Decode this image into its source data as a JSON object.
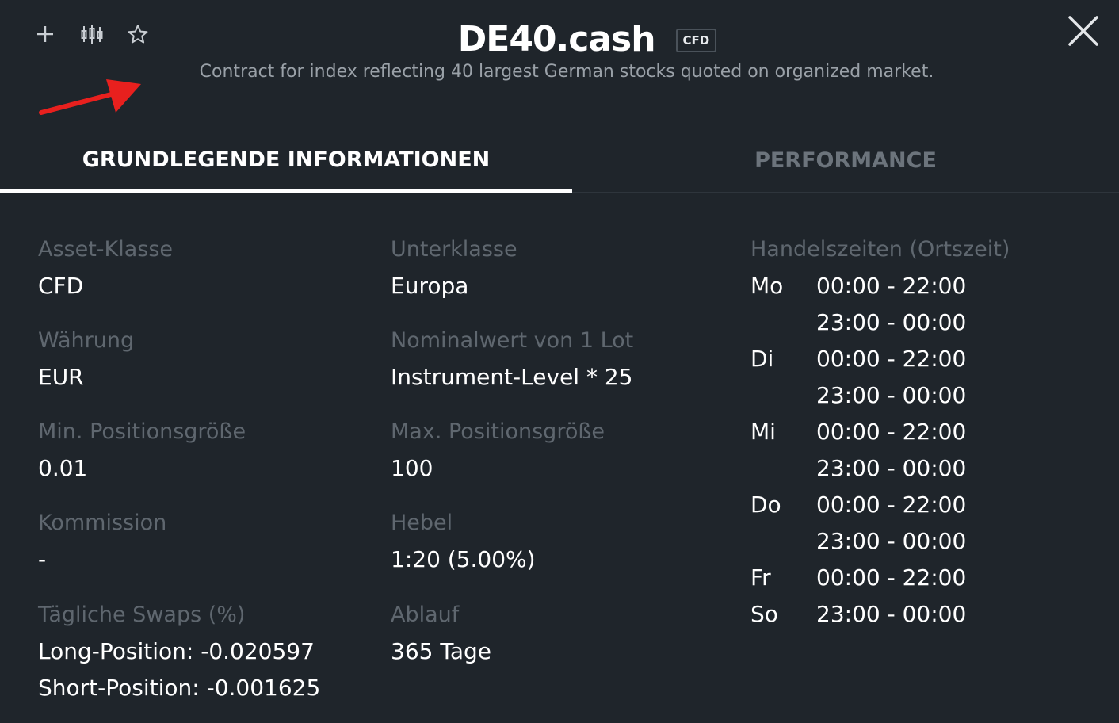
{
  "header": {
    "title": "DE40.cash",
    "badge": "CFD",
    "description": "Contract for index reflecting 40 largest German stocks quoted on organized market.",
    "icons": [
      "plus-icon",
      "candlestick-chart-icon",
      "star-icon",
      "close-icon"
    ]
  },
  "tabs": [
    {
      "label": "GRUNDLEGENDE INFORMATIONEN",
      "active": true
    },
    {
      "label": "PERFORMANCE",
      "active": false
    }
  ],
  "info": {
    "asset_class": {
      "label": "Asset-Klasse",
      "value": "CFD"
    },
    "subclass": {
      "label": "Unterklasse",
      "value": "Europa"
    },
    "currency": {
      "label": "Währung",
      "value": "EUR"
    },
    "nominal": {
      "label": "Nominalwert von 1 Lot",
      "value": "Instrument-Level * 25"
    },
    "min_size": {
      "label": "Min. Positionsgröße",
      "value": "0.01"
    },
    "max_size": {
      "label": "Max. Positionsgröße",
      "value": "100"
    },
    "commission": {
      "label": "Kommission",
      "value": "-"
    },
    "leverage": {
      "label": "Hebel",
      "value": "1:20 (5.00%)"
    },
    "swaps": {
      "label": "Tägliche Swaps (%)",
      "long": "Long-Position: -0.020597",
      "short": "Short-Position: -0.001625"
    },
    "expiry": {
      "label": "Ablauf",
      "value": "365 Tage"
    }
  },
  "trading_hours": {
    "label": "Handelszeiten (Ortszeit)",
    "rows": [
      {
        "day": "Mo",
        "time": "00:00 - 22:00"
      },
      {
        "day": "",
        "time": "23:00 - 00:00"
      },
      {
        "day": "Di",
        "time": "00:00 - 22:00"
      },
      {
        "day": "",
        "time": "23:00 - 00:00"
      },
      {
        "day": "Mi",
        "time": "00:00 - 22:00"
      },
      {
        "day": "",
        "time": "23:00 - 00:00"
      },
      {
        "day": "Do",
        "time": "00:00 - 22:00"
      },
      {
        "day": "",
        "time": "23:00 - 00:00"
      },
      {
        "day": "Fr",
        "time": "00:00 - 22:00"
      },
      {
        "day": "So",
        "time": "23:00 - 00:00"
      }
    ]
  },
  "colors": {
    "background": "#1f252b",
    "label": "#5f676f",
    "value": "#ffffff",
    "annotation_arrow": "#e8201e"
  }
}
